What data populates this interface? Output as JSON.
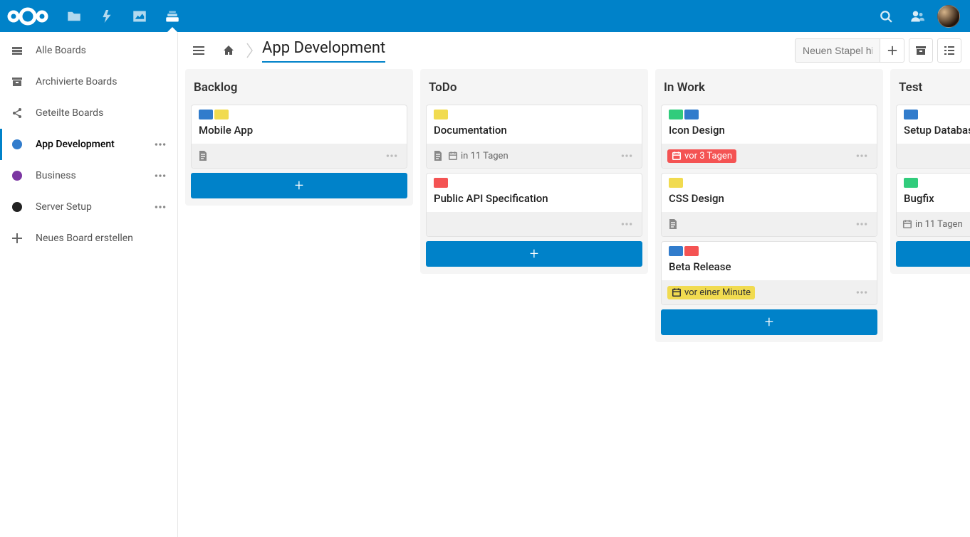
{
  "colors": {
    "brand": "#0082c9",
    "blue": "#317ccc",
    "yellow": "#f1db50",
    "green": "#31cc7c",
    "red": "#f45353",
    "purple": "#7b36a2",
    "black": "#222222"
  },
  "sidebar": {
    "items": [
      {
        "id": "all",
        "label": "Alle Boards",
        "icon": "drawer",
        "actions": false
      },
      {
        "id": "archived",
        "label": "Archivierte Boards",
        "icon": "archive",
        "actions": false
      },
      {
        "id": "shared",
        "label": "Geteilte Boards",
        "icon": "share",
        "actions": false
      },
      {
        "id": "appdev",
        "label": "App Development",
        "icon": "dot",
        "dot": "#317ccc",
        "actions": true,
        "active": true
      },
      {
        "id": "business",
        "label": "Business",
        "icon": "dot",
        "dot": "#7b36a2",
        "actions": true
      },
      {
        "id": "server",
        "label": "Server Setup",
        "icon": "dot",
        "dot": "#222222",
        "actions": true
      },
      {
        "id": "new",
        "label": "Neues Board erstellen",
        "icon": "plus",
        "actions": false
      }
    ]
  },
  "header": {
    "board_title": "App Development",
    "new_stack_placeholder": "Neuen Stapel hinzufügen"
  },
  "stacks": [
    {
      "title": "Backlog",
      "cards": [
        {
          "title": "Mobile App",
          "tags": [
            "blue",
            "yellow"
          ],
          "has_desc": true,
          "due": null,
          "due_style": null
        }
      ]
    },
    {
      "title": "ToDo",
      "cards": [
        {
          "title": "Documentation",
          "tags": [
            "yellow"
          ],
          "has_desc": true,
          "due": "in 11 Tagen",
          "due_style": "plain"
        },
        {
          "title": "Public API Specification",
          "tags": [
            "red"
          ],
          "has_desc": false,
          "due": null,
          "due_style": null
        }
      ]
    },
    {
      "title": "In Work",
      "cards": [
        {
          "title": "Icon Design",
          "tags": [
            "green",
            "blue"
          ],
          "has_desc": false,
          "due": "vor 3 Tagen",
          "due_style": "overdue"
        },
        {
          "title": "CSS Design",
          "tags": [
            "yellow"
          ],
          "has_desc": true,
          "due": null,
          "due_style": null
        },
        {
          "title": "Beta Release",
          "tags": [
            "blue",
            "red"
          ],
          "has_desc": false,
          "due": "vor einer Minute",
          "due_style": "soon"
        }
      ]
    },
    {
      "title": "Test",
      "cards": [
        {
          "title": "Setup Database",
          "tags": [
            "blue"
          ],
          "has_desc": false,
          "due": null,
          "due_style": null
        },
        {
          "title": "Bugfix",
          "tags": [
            "green"
          ],
          "has_desc": false,
          "due": "in 11 Tagen",
          "due_style": "plain"
        }
      ]
    }
  ]
}
